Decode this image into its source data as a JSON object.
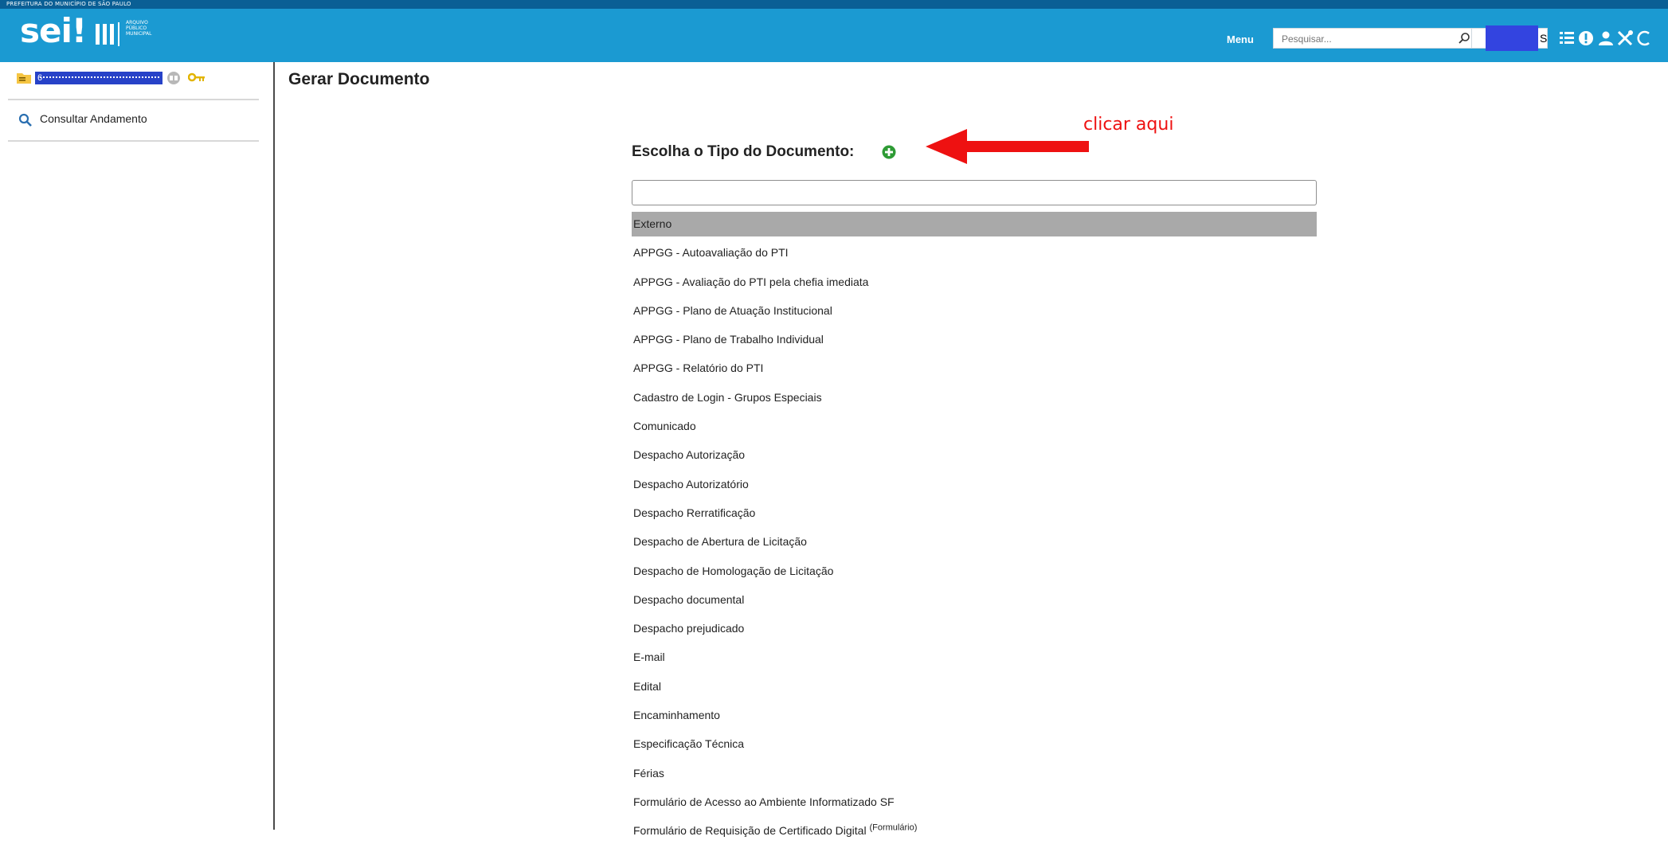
{
  "header": {
    "org_name": "PREFEITURA DO MUNICÍPIO DE SÃO PAULO",
    "logo_text": "sei!",
    "logo_subtext_lines": [
      "ARQUIVO",
      "PÚBLICO",
      "MUNICIPAL"
    ],
    "menu_label": "Menu",
    "search_placeholder": "Pesquisar...",
    "unit_suffix": "S",
    "accent_color": "#1b9ad2",
    "topbar_color": "#0a5f95",
    "icons": [
      "search-icon",
      "control-panel-icon",
      "info-icon",
      "user-icon",
      "tools-icon"
    ]
  },
  "sidebar": {
    "process_number": "6",
    "consult_label": "Consultar Andamento"
  },
  "main": {
    "page_title": "Gerar Documento",
    "choose_label": "Escolha o Tipo do Documento:",
    "filter_value": "",
    "document_types": [
      "Externo",
      "APPGG - Autoavaliação do PTI",
      "APPGG - Avaliação do PTI pela chefia imediata",
      "APPGG - Plano de Atuação Institucional",
      "APPGG - Plano de Trabalho Individual",
      "APPGG - Relatório do PTI",
      "Cadastro de Login - Grupos Especiais",
      "Comunicado",
      "Despacho Autorização",
      "Despacho Autorizatório",
      "Despacho Rerratificação",
      "Despacho de Abertura de Licitação",
      "Despacho de Homologação de Licitação",
      "Despacho documental",
      "Despacho prejudicado",
      "E-mail",
      "Edital",
      "Encaminhamento",
      "Especificação Técnica",
      "Férias",
      "Formulário de Acesso ao Ambiente Informatizado SF",
      "Formulário de Requisição de Certificado Digital"
    ],
    "last_item_tag": "(Formulário)",
    "selected_index": 0
  },
  "annotation": {
    "text": "clicar aqui",
    "color": "#ee1111"
  }
}
